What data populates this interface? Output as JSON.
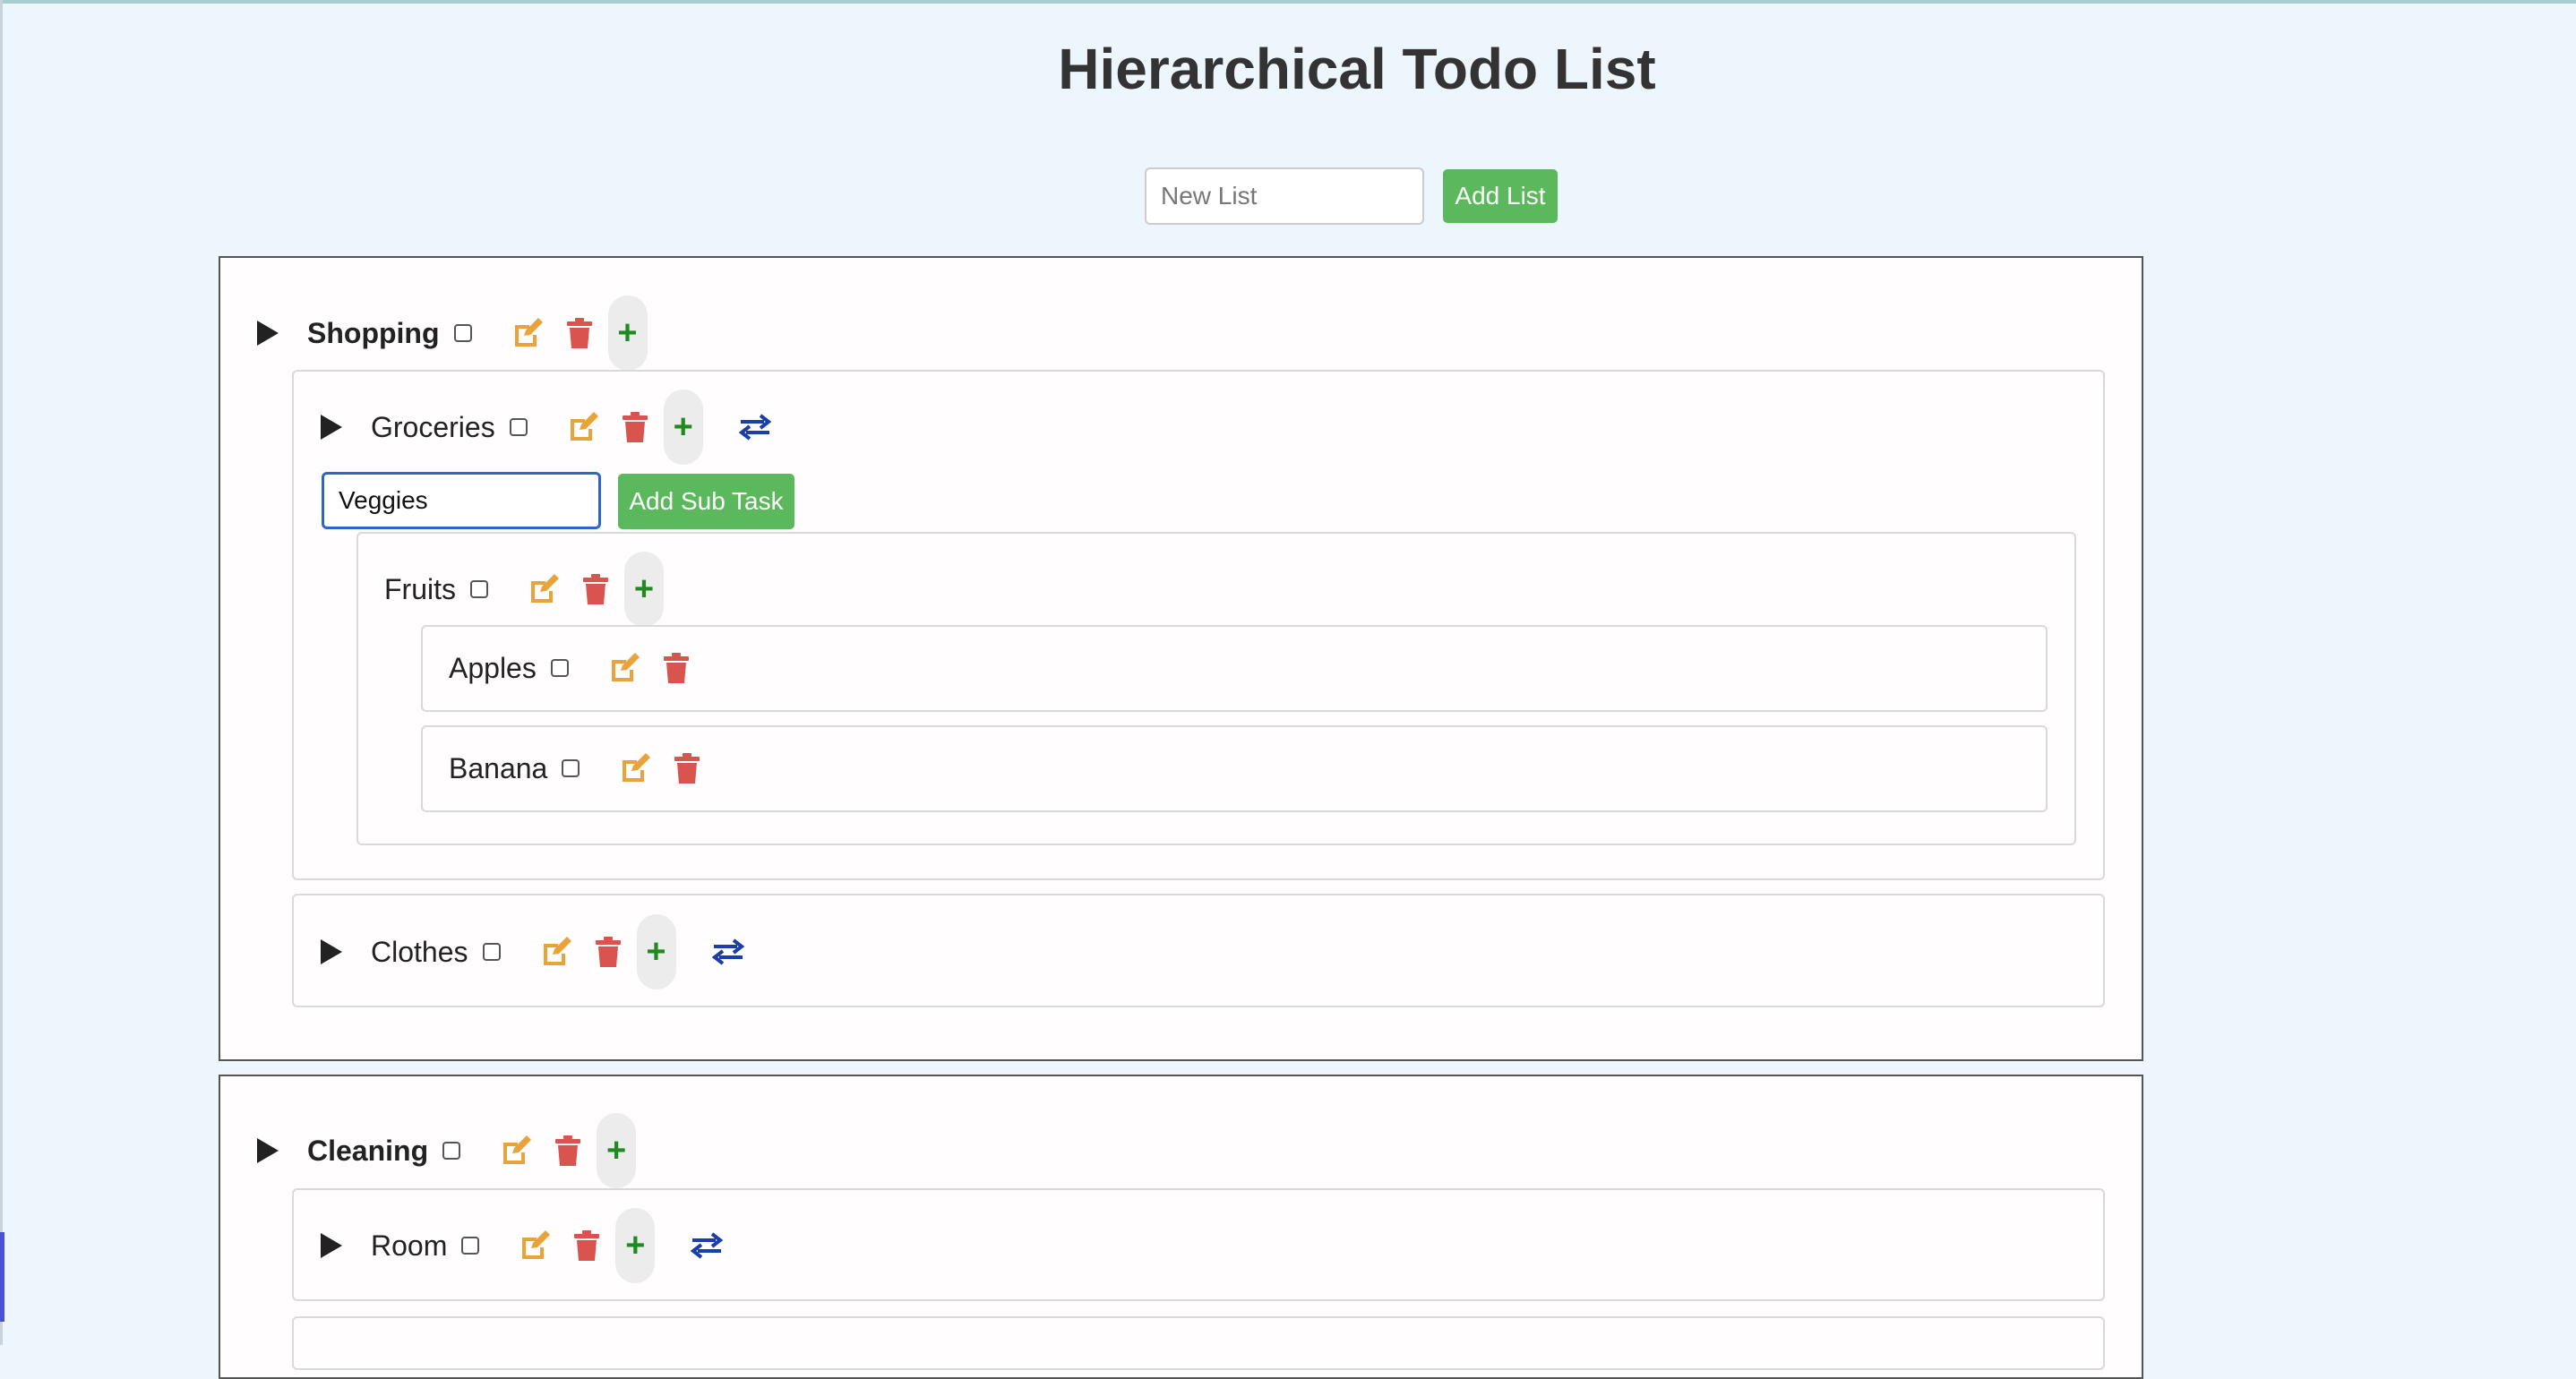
{
  "page": {
    "title": "Hierarchical Todo List"
  },
  "new_list": {
    "placeholder": "New List",
    "button": "Add List"
  },
  "sub_task": {
    "value": "Veggies",
    "button": "Add Sub Task"
  },
  "lists": [
    {
      "name": "Shopping",
      "children": [
        {
          "name": "Groceries",
          "children": [
            {
              "name": "Fruits",
              "children": [
                {
                  "name": "Apples"
                },
                {
                  "name": "Banana"
                }
              ]
            }
          ]
        },
        {
          "name": "Clothes"
        }
      ]
    },
    {
      "name": "Cleaning",
      "children": [
        {
          "name": "Room"
        }
      ]
    }
  ],
  "icons": {
    "expand": "caret-right-icon",
    "edit": "edit-icon",
    "delete": "trash-icon",
    "add": "plus-icon",
    "move": "swap-arrows-icon"
  },
  "colors": {
    "accent_green": "#5cb85c",
    "edit_orange": "#e8a33a",
    "delete_red": "#d9534f",
    "plus_green": "#1f8a1f",
    "move_blue": "#1a3fa8",
    "focus_blue": "#2d66c8"
  }
}
